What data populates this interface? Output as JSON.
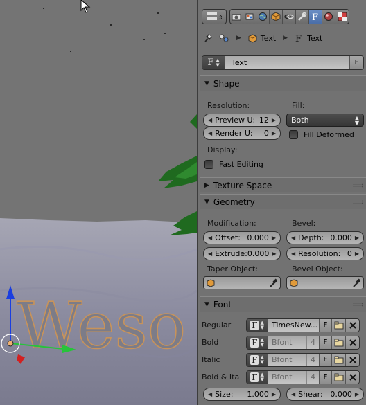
{
  "viewport": {
    "scene_text": "Weso"
  },
  "properties": {
    "tabs": {
      "editor_icon": "properties-editor-icon",
      "items": [
        {
          "icon": "render-icon"
        },
        {
          "icon": "scene-icon"
        },
        {
          "icon": "world-icon"
        },
        {
          "icon": "object-icon"
        },
        {
          "icon": "constraints-icon"
        },
        {
          "icon": "modifiers-icon"
        },
        {
          "icon": "data-font-icon",
          "active": true
        },
        {
          "icon": "material-icon"
        },
        {
          "icon": "texture-icon"
        }
      ]
    },
    "breadcrumb": {
      "object_label": "Text",
      "data_label": "Text"
    },
    "datablock": {
      "type_glyph": "F",
      "name": "Text",
      "fake_user": "F"
    },
    "shape": {
      "header": "Shape",
      "resolution_label": "Resolution:",
      "preview_u_label": "Preview U:",
      "preview_u_value": "12",
      "render_u_label": "Render U:",
      "render_u_value": "0",
      "fill_label": "Fill:",
      "fill_value": "Both",
      "fill_deformed_label": "Fill Deformed",
      "display_label": "Display:",
      "fast_editing_label": "Fast Editing"
    },
    "texture_space": {
      "header": "Texture Space"
    },
    "geometry": {
      "header": "Geometry",
      "modification_label": "Modification:",
      "offset_label": "Offset:",
      "offset_value": "0.000",
      "extrude_label": "Extrude:",
      "extrude_value": "0.000",
      "bevel_label": "Bevel:",
      "depth_label": "Depth:",
      "depth_value": "0.000",
      "resolution_label": "Resolution:",
      "resolution_value": "0",
      "taper_object_label": "Taper Object:",
      "bevel_object_label": "Bevel Object:"
    },
    "font": {
      "header": "Font",
      "rows": [
        {
          "label": "Regular",
          "name": "TimesNew...",
          "users": "",
          "fake": "F"
        },
        {
          "label": "Bold",
          "name": "Bfont",
          "users": "4",
          "fake": "F"
        },
        {
          "label": "Italic",
          "name": "Bfont",
          "users": "4",
          "fake": "F"
        },
        {
          "label": "Bold & Ita",
          "name": "Bfont",
          "users": "4",
          "fake": "F"
        }
      ],
      "size_label": "Size:",
      "size_value": "1.000",
      "shear_label": "Shear:",
      "shear_value": "0.000"
    }
  },
  "colors": {
    "active_tab": "#5a7fb8",
    "text_outline": "#c8935a",
    "axis_z": "#1a3ee0",
    "axis_y": "#27c43a",
    "axis_x": "#d32020"
  }
}
